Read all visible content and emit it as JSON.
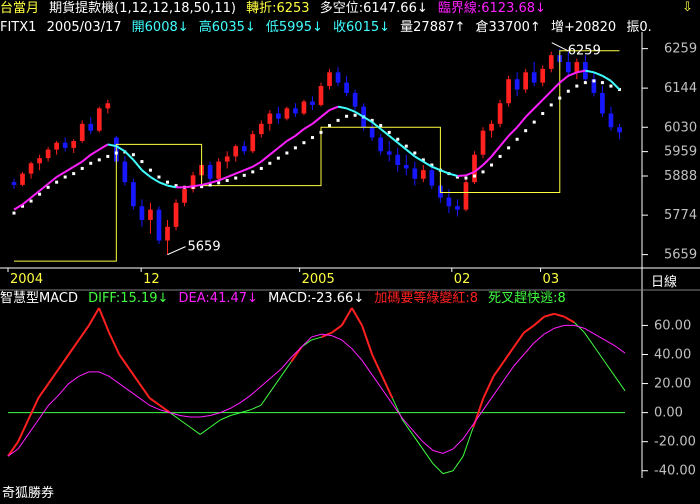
{
  "colors": {
    "up": "#ff2020",
    "down": "#1818ff",
    "pink": "#ff20ff",
    "cyan": "#40ffff",
    "white": "#ffffff",
    "yellow": "#ffff40",
    "green": "#40ff40",
    "grid": "#c0c0c0",
    "axis": "#ffffff"
  },
  "header": {
    "title": "台當月",
    "indicator": "期貨提款機(1,12,12,18,50,11)",
    "turn": "轉折:6253",
    "bull": "多空位:6147.66↓",
    "critical": "臨界線:6123.68↓",
    "arrow_icon": "down-arrow-icon"
  },
  "quote": {
    "symbol": "FITX1",
    "date": "2005/03/17",
    "open": "開6008↓",
    "high": "高6035↓",
    "low": "低5995↓",
    "close": "收6015↓",
    "volume": "量27887↑",
    "oi": "倉33700↑",
    "chg": "增+20820",
    "amp": "振0."
  },
  "price_axis": [
    "6259",
    "6144",
    "6030",
    "5959",
    "5888",
    "5774",
    "5659"
  ],
  "annotations": {
    "high": "6259",
    "low": "5659"
  },
  "time_axis": [
    "2004",
    "12",
    "2005",
    "02",
    "03"
  ],
  "period": "日線",
  "macd": {
    "name": "智慧型MACD",
    "diff": "DIFF:15.19↓",
    "dea": "DEA:41.47↓",
    "macd": "MACD:-23.66↓",
    "signal1": "加碼要等綠變紅:8",
    "signal2": "死叉趕快逃:8",
    "axis": [
      "60.00",
      "40.00",
      "20.00",
      "0.00",
      "-20.00",
      "-40.00"
    ]
  },
  "brand": "奇狐勝券",
  "chart_data": {
    "type": "line",
    "price_ylim": [
      5620,
      6290
    ],
    "macd_ylim": [
      -45,
      72
    ],
    "candles": [
      [
        5870,
        5880,
        5850,
        5862
      ],
      [
        5862,
        5900,
        5858,
        5895
      ],
      [
        5895,
        5930,
        5880,
        5925
      ],
      [
        5925,
        5950,
        5905,
        5940
      ],
      [
        5940,
        5972,
        5930,
        5965
      ],
      [
        5965,
        5990,
        5950,
        5985
      ],
      [
        5985,
        6000,
        5960,
        5970
      ],
      [
        5970,
        5995,
        5955,
        5990
      ],
      [
        5990,
        6050,
        5985,
        6040
      ],
      [
        6040,
        6060,
        6010,
        6020
      ],
      [
        6020,
        6090,
        6015,
        6085
      ],
      [
        6085,
        6110,
        6070,
        6100
      ],
      [
        6000,
        6005,
        5920,
        5930
      ],
      [
        5930,
        5945,
        5860,
        5870
      ],
      [
        5870,
        5880,
        5790,
        5800
      ],
      [
        5800,
        5820,
        5740,
        5760
      ],
      [
        5760,
        5810,
        5720,
        5790
      ],
      [
        5790,
        5800,
        5690,
        5700
      ],
      [
        5700,
        5760,
        5659,
        5740
      ],
      [
        5740,
        5820,
        5730,
        5810
      ],
      [
        5810,
        5860,
        5800,
        5850
      ],
      [
        5850,
        5900,
        5840,
        5890
      ],
      [
        5890,
        5930,
        5870,
        5920
      ],
      [
        5920,
        5930,
        5870,
        5880
      ],
      [
        5880,
        5940,
        5875,
        5930
      ],
      [
        5930,
        5960,
        5910,
        5945
      ],
      [
        5945,
        5980,
        5930,
        5975
      ],
      [
        5975,
        5990,
        5950,
        5960
      ],
      [
        5960,
        6020,
        5955,
        6010
      ],
      [
        6010,
        6050,
        6000,
        6040
      ],
      [
        6040,
        6080,
        6020,
        6070
      ],
      [
        6070,
        6090,
        6040,
        6055
      ],
      [
        6055,
        6090,
        6050,
        6085
      ],
      [
        6085,
        6100,
        6060,
        6070
      ],
      [
        6070,
        6110,
        6065,
        6105
      ],
      [
        6105,
        6120,
        6080,
        6095
      ],
      [
        6095,
        6160,
        6090,
        6150
      ],
      [
        6150,
        6200,
        6140,
        6190
      ],
      [
        6190,
        6205,
        6150,
        6160
      ],
      [
        6160,
        6180,
        6120,
        6130
      ],
      [
        6130,
        6140,
        6080,
        6090
      ],
      [
        6090,
        6100,
        6020,
        6030
      ],
      [
        6030,
        6050,
        5990,
        6000
      ],
      [
        6000,
        6010,
        5950,
        5960
      ],
      [
        5960,
        5990,
        5930,
        5950
      ],
      [
        5950,
        5970,
        5900,
        5920
      ],
      [
        5920,
        5950,
        5890,
        5910
      ],
      [
        5910,
        5930,
        5860,
        5880
      ],
      [
        5880,
        5920,
        5870,
        5905
      ],
      [
        5905,
        5915,
        5850,
        5860
      ],
      [
        5860,
        5880,
        5810,
        5825
      ],
      [
        5825,
        5850,
        5780,
        5800
      ],
      [
        5800,
        5820,
        5770,
        5790
      ],
      [
        5790,
        5880,
        5785,
        5870
      ],
      [
        5870,
        5960,
        5865,
        5950
      ],
      [
        5950,
        6030,
        5940,
        6020
      ],
      [
        6020,
        6050,
        6000,
        6040
      ],
      [
        6040,
        6110,
        6030,
        6100
      ],
      [
        6100,
        6180,
        6090,
        6170
      ],
      [
        6170,
        6190,
        6120,
        6140
      ],
      [
        6140,
        6200,
        6130,
        6190
      ],
      [
        6190,
        6220,
        6150,
        6160
      ],
      [
        6160,
        6210,
        6150,
        6200
      ],
      [
        6200,
        6250,
        6190,
        6240
      ],
      [
        6240,
        6259,
        6200,
        6220
      ],
      [
        6220,
        6250,
        6180,
        6190
      ],
      [
        6190,
        6230,
        6170,
        6220
      ],
      [
        6220,
        6240,
        6160,
        6170
      ],
      [
        6170,
        6190,
        6120,
        6130
      ],
      [
        6130,
        6150,
        6060,
        6070
      ],
      [
        6070,
        6090,
        6020,
        6030
      ],
      [
        6030,
        6040,
        5995,
        6015
      ]
    ],
    "ma_cyan": [
      5790,
      5805,
      5825,
      5845,
      5865,
      5885,
      5900,
      5915,
      5930,
      5950,
      5965,
      5980,
      5975,
      5960,
      5935,
      5905,
      5885,
      5870,
      5860,
      5855,
      5855,
      5858,
      5862,
      5868,
      5875,
      5885,
      5895,
      5905,
      5915,
      5930,
      5950,
      5970,
      5990,
      6005,
      6025,
      6040,
      6060,
      6080,
      6090,
      6085,
      6075,
      6060,
      6045,
      6025,
      6005,
      5985,
      5965,
      5945,
      5930,
      5915,
      5905,
      5895,
      5888,
      5890,
      5900,
      5920,
      5945,
      5975,
      6005,
      6030,
      6060,
      6085,
      6110,
      6135,
      6160,
      6180,
      6190,
      6195,
      6190,
      6180,
      6165,
      6140
    ],
    "dots_white": [
      5780,
      5800,
      5815,
      5835,
      5855,
      5870,
      5885,
      5895,
      5910,
      5925,
      5935,
      5945,
      5955,
      5958,
      5950,
      5930,
      5905,
      5885,
      5870,
      5860,
      5855,
      5855,
      5857,
      5862,
      5868,
      5875,
      5882,
      5890,
      5900,
      5910,
      5925,
      5940,
      5955,
      5970,
      5985,
      6000,
      6015,
      6035,
      6050,
      6062,
      6065,
      6060,
      6050,
      6035,
      6015,
      5995,
      5975,
      5955,
      5935,
      5920,
      5905,
      5895,
      5885,
      5882,
      5888,
      5900,
      5920,
      5945,
      5970,
      5995,
      6020,
      6045,
      6070,
      6095,
      6115,
      6135,
      6150,
      6160,
      6165,
      6160,
      6150,
      6140
    ],
    "yellow_line": [
      5640,
      5640,
      5640,
      5640,
      5640,
      5640,
      5640,
      5640,
      5640,
      5640,
      5640,
      5640,
      5980,
      5980,
      5980,
      5980,
      5980,
      5980,
      5980,
      5980,
      5980,
      5980,
      5860,
      5860,
      5860,
      5860,
      5860,
      5860,
      5860,
      5860,
      5860,
      5860,
      5860,
      5860,
      5860,
      5860,
      6030,
      6030,
      6030,
      6030,
      6030,
      6030,
      6030,
      6030,
      6030,
      6030,
      6030,
      6030,
      6030,
      6030,
      5840,
      5840,
      5840,
      5840,
      5840,
      5840,
      5840,
      5840,
      5840,
      5840,
      5840,
      5840,
      5840,
      5840,
      6253,
      6253,
      6253,
      6253,
      6253,
      6253,
      6253,
      6253
    ],
    "macd_diff": [
      -30,
      -20,
      -5,
      10,
      20,
      30,
      40,
      50,
      60,
      72,
      55,
      40,
      30,
      20,
      10,
      5,
      0,
      -5,
      -10,
      -15,
      -10,
      -5,
      -2,
      0,
      2,
      5,
      15,
      25,
      35,
      45,
      50,
      52,
      55,
      60,
      72,
      60,
      40,
      25,
      10,
      -5,
      -15,
      -25,
      -35,
      -42,
      -40,
      -30,
      -10,
      10,
      25,
      35,
      45,
      55,
      60,
      66,
      68,
      66,
      62,
      55,
      45,
      35,
      25,
      15
    ],
    "macd_dea": [
      -30,
      -25,
      -15,
      -5,
      5,
      12,
      20,
      25,
      28,
      28,
      25,
      20,
      15,
      10,
      5,
      2,
      0,
      -2,
      -3,
      -3,
      -2,
      0,
      3,
      7,
      12,
      18,
      24,
      30,
      38,
      45,
      52,
      54,
      53,
      50,
      44,
      36,
      26,
      16,
      6,
      -4,
      -12,
      -20,
      -26,
      -28,
      -25,
      -18,
      -8,
      2,
      12,
      22,
      32,
      40,
      48,
      54,
      58,
      60,
      60,
      58,
      54,
      50,
      46,
      41
    ]
  }
}
